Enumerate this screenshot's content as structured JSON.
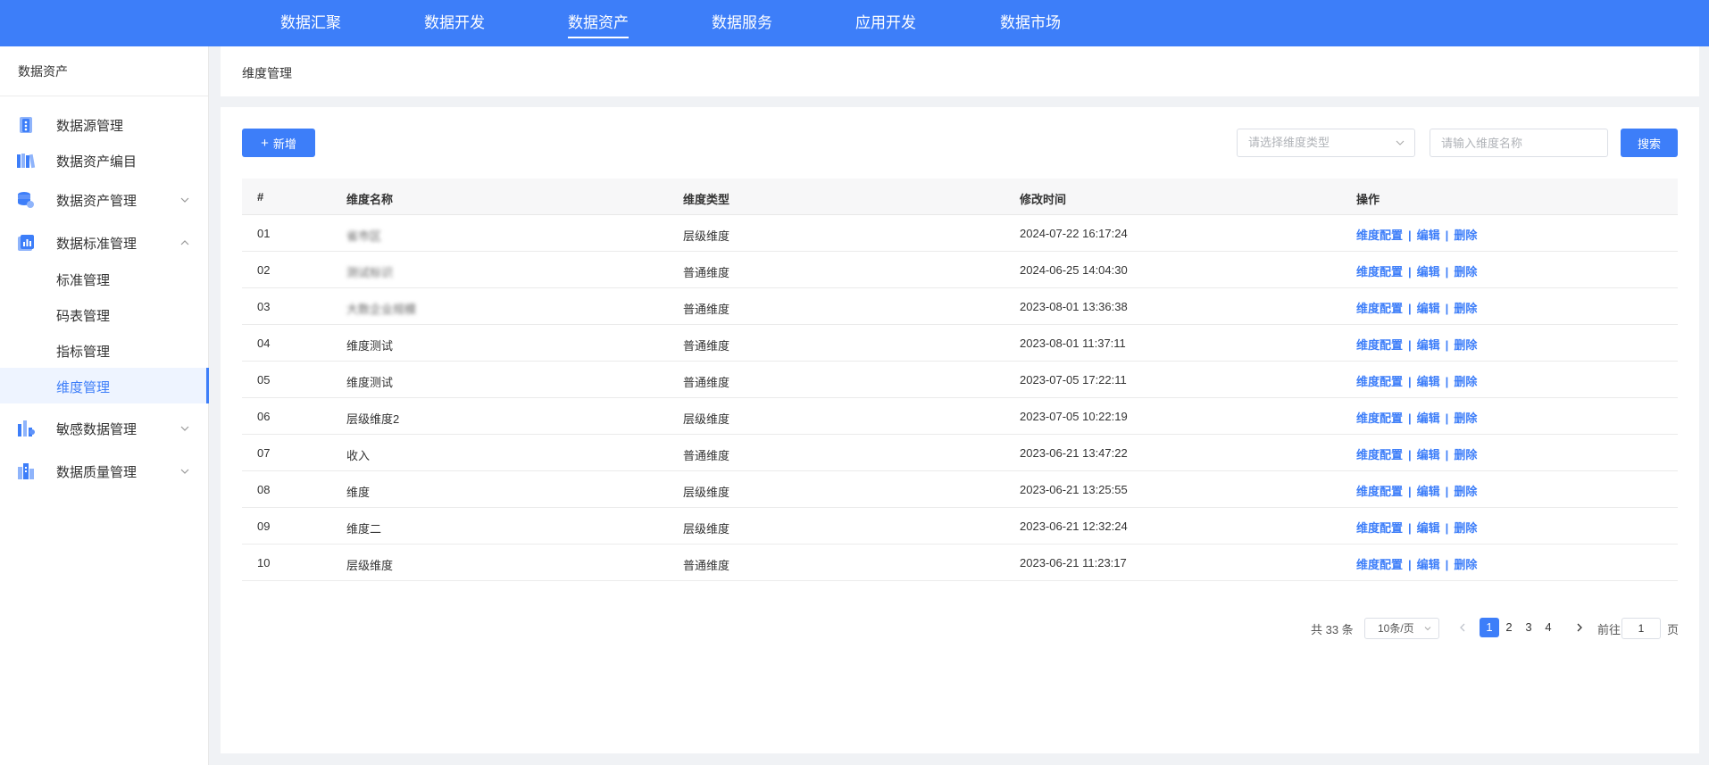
{
  "topnav": {
    "items": [
      {
        "label": "数据汇聚"
      },
      {
        "label": "数据开发"
      },
      {
        "label": "数据资产",
        "active": true
      },
      {
        "label": "数据服务"
      },
      {
        "label": "应用开发"
      },
      {
        "label": "数据市场"
      }
    ]
  },
  "sidebar": {
    "title": "数据资产",
    "items": [
      {
        "label": "数据源管理",
        "icon": "database-source-icon"
      },
      {
        "label": "数据资产编目",
        "icon": "catalog-books-icon"
      },
      {
        "label": "数据资产管理",
        "icon": "database-stack-icon",
        "expandable": true,
        "expanded": false
      },
      {
        "label": "数据标准管理",
        "icon": "standard-chart-icon",
        "expandable": true,
        "expanded": true
      },
      {
        "label": "敏感数据管理",
        "icon": "sensitive-chart-icon",
        "expandable": true,
        "expanded": false
      },
      {
        "label": "数据质量管理",
        "icon": "quality-bars-icon",
        "expandable": true,
        "expanded": false
      }
    ],
    "subitems": [
      {
        "label": "标准管理"
      },
      {
        "label": "码表管理"
      },
      {
        "label": "指标管理"
      },
      {
        "label": "维度管理",
        "active": true
      }
    ]
  },
  "breadcrumb": "维度管理",
  "toolbar": {
    "add_label": "新增",
    "type_select_placeholder": "请选择维度类型",
    "name_input_placeholder": "请输入维度名称",
    "search_label": "搜索"
  },
  "table": {
    "headers": [
      "#",
      "维度名称",
      "维度类型",
      "修改时间",
      "操作"
    ],
    "rows": [
      {
        "no": "01",
        "name": "省市区",
        "type": "层级维度",
        "time": "2024-07-22 16:17:24",
        "blurred": true
      },
      {
        "no": "02",
        "name": "测试标识",
        "type": "普通维度",
        "time": "2024-06-25 14:04:30",
        "blurred": true
      },
      {
        "no": "03",
        "name": "大数企业规模",
        "type": "普通维度",
        "time": "2023-08-01 13:36:38",
        "blurred": true
      },
      {
        "no": "04",
        "name": "维度测试",
        "type": "普通维度",
        "time": "2023-08-01 11:37:11"
      },
      {
        "no": "05",
        "name": "维度测试",
        "type": "普通维度",
        "time": "2023-07-05 17:22:11"
      },
      {
        "no": "06",
        "name": "层级维度2",
        "type": "层级维度",
        "time": "2023-07-05 10:22:19"
      },
      {
        "no": "07",
        "name": "收入",
        "type": "普通维度",
        "time": "2023-06-21 13:47:22"
      },
      {
        "no": "08",
        "name": "维度",
        "type": "层级维度",
        "time": "2023-06-21 13:25:55"
      },
      {
        "no": "09",
        "name": "维度二",
        "type": "层级维度",
        "time": "2023-06-21 12:32:24"
      },
      {
        "no": "10",
        "name": "层级维度",
        "type": "普通维度",
        "time": "2023-06-21 11:23:17"
      }
    ],
    "actions": {
      "config": "维度配置",
      "edit": "编辑",
      "delete": "删除",
      "separator": "|"
    }
  },
  "pagination": {
    "total": "共 33 条",
    "page_size": "10条/页",
    "pages": [
      "1",
      "2",
      "3",
      "4"
    ],
    "current": "1",
    "goto_label": "前往",
    "goto_value": "1",
    "page_suffix": "页"
  },
  "colors": {
    "primary": "#3d7ef9",
    "background": "#f0f2f5"
  }
}
